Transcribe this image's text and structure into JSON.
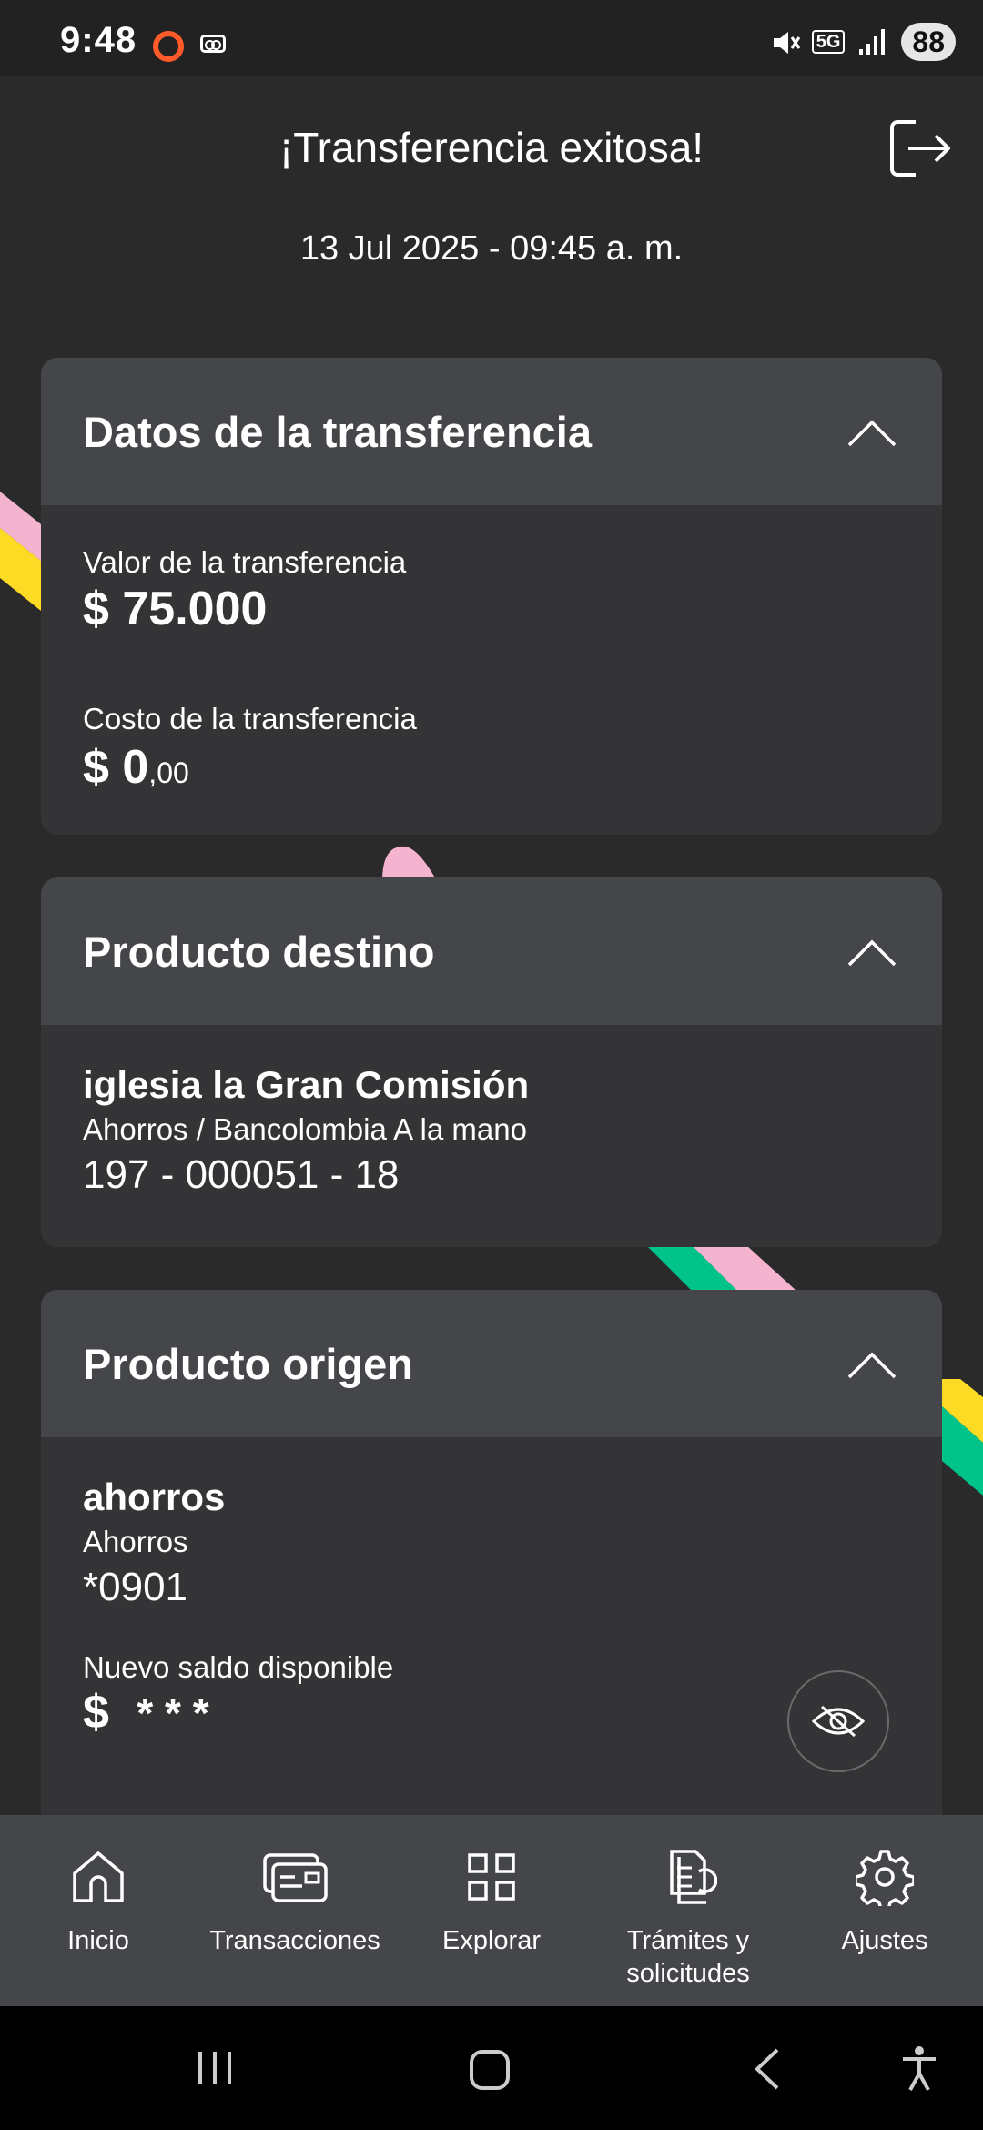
{
  "status_bar": {
    "time": "9:48",
    "network": "5G",
    "battery": "88"
  },
  "header": {
    "title": "¡Transferencia exitosa!",
    "date": "13 Jul 2025 - 09:45 a. m."
  },
  "transfer_card": {
    "title": "Datos de la transferencia",
    "value_label": "Valor de la transferencia",
    "value": "$ 75.000",
    "cost_label": "Costo de la transferencia",
    "cost_main": "$ 0",
    "cost_cents": ",00"
  },
  "destination_card": {
    "title": "Producto destino",
    "name": "iglesia la Gran Comisión",
    "account_type": "Ahorros / Bancolombia A la mano",
    "account_number": "197 - 000051 - 18"
  },
  "origin_card": {
    "title": "Producto origen",
    "name": "ahorros",
    "account_type": "Ahorros",
    "account_number": "*0901",
    "balance_label": "Nuevo saldo disponible",
    "balance_currency": "$",
    "balance_hidden": "* * *"
  },
  "bottom_nav": {
    "items": [
      {
        "label": "Inicio",
        "icon": "home-icon"
      },
      {
        "label": "Transacciones",
        "icon": "transactions-icon"
      },
      {
        "label": "Explorar",
        "icon": "grid-icon"
      },
      {
        "label": "Trámites y solicitudes",
        "icon": "documents-icon"
      },
      {
        "label": "Ajustes",
        "icon": "gear-icon"
      }
    ]
  },
  "colors": {
    "background": "#2b2a2a",
    "card": "#343436",
    "card_header": "#454649",
    "accent_yellow": "#fdda24",
    "accent_pink": "#f4b4cf",
    "accent_green": "#00c389"
  }
}
